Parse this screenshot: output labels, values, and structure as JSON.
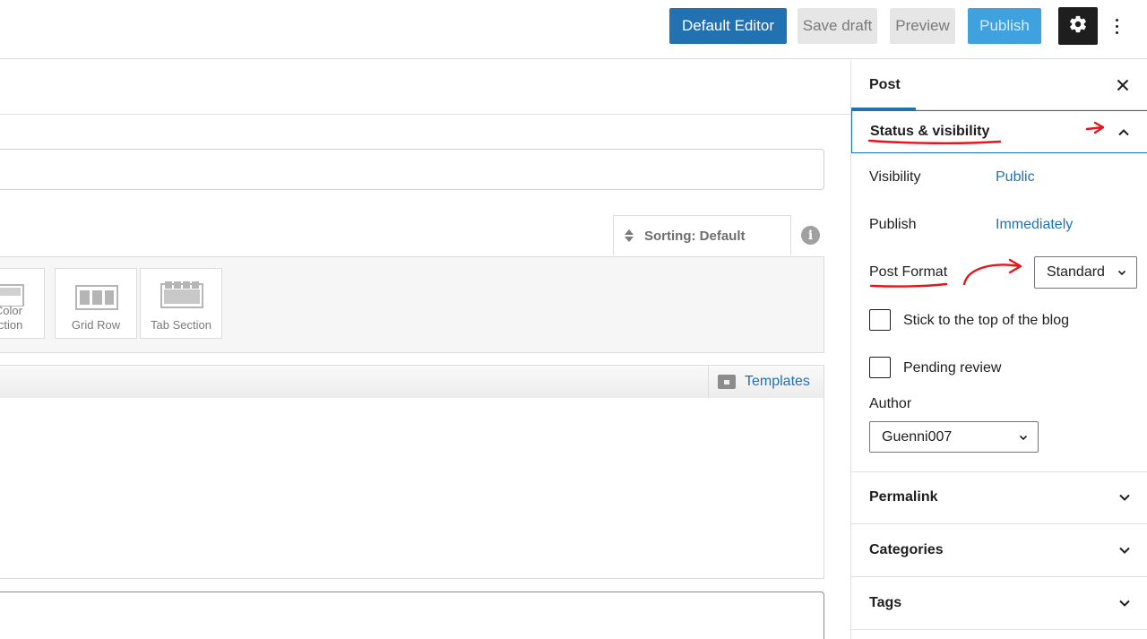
{
  "toolbar": {
    "default_editor_label": "Default Editor",
    "save_draft_label": "Save draft",
    "preview_label": "Preview",
    "publish_label": "Publish",
    "colors": {
      "primary": "#2271b1",
      "publish_disabled": "#3fa1dd",
      "settings_bg": "#1e1e1e"
    }
  },
  "editor": {
    "sorting_label": "Sorting: Default",
    "elements": [
      {
        "label": "Color\nSection"
      },
      {
        "label": "Grid Row"
      },
      {
        "label": "Tab Section"
      }
    ],
    "templates_label": "Templates"
  },
  "sidebar": {
    "tab_post": "Post",
    "status_visibility": {
      "title": "Status & visibility",
      "visibility_label": "Visibility",
      "visibility_value": "Public",
      "publish_label": "Publish",
      "publish_value": "Immediately",
      "post_format_label": "Post Format",
      "post_format_value": "Standard",
      "stick_top_label": "Stick to the top of the blog",
      "pending_review_label": "Pending review",
      "author_label": "Author",
      "author_value": "Guenni007"
    },
    "permalink_title": "Permalink",
    "categories_title": "Categories",
    "tags_title": "Tags"
  }
}
